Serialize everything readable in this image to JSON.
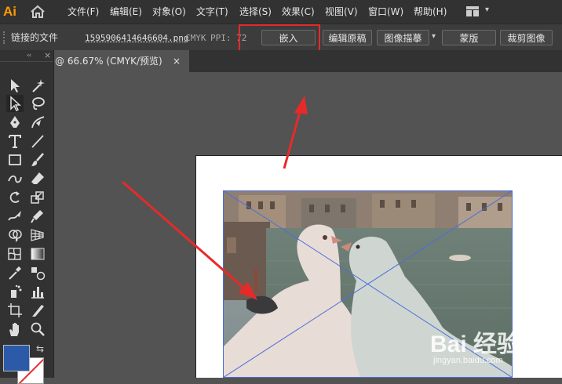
{
  "app": {
    "logo_text": "Ai",
    "icons": {
      "home": "home-icon",
      "workspace": "workspace-switcher-icon"
    }
  },
  "menu": [
    "文件(F)",
    "编辑(E)",
    "对象(O)",
    "文字(T)",
    "选择(S)",
    "效果(C)",
    "视图(V)",
    "窗口(W)",
    "帮助(H)"
  ],
  "control_bar": {
    "linked_label": "链接的文件",
    "filename": "1595906414646604.png",
    "color_mode": "CMYK",
    "ppi": "PPI: 72",
    "buttons": {
      "embed": "嵌入",
      "edit_original": "编辑原稿",
      "image_trace": "图像描摹",
      "mask": "蒙版",
      "crop": "裁剪图像"
    }
  },
  "document_tab": {
    "label": "@ 66.67% (CMYK/预览)",
    "close": "×"
  },
  "toolbar": {
    "tools": [
      "selection-tool",
      "magic-wand-tool",
      "direct-selection-tool",
      "lasso-tool",
      "pen-tool",
      "curvature-tool",
      "type-tool",
      "line-segment-tool",
      "rectangle-tool",
      "paintbrush-tool",
      "shaper-tool",
      "eraser-tool",
      "rotate-tool",
      "scale-tool",
      "warp-tool",
      "free-transform-tool",
      "shape-builder-tool",
      "perspective-grid-tool",
      "mesh-tool",
      "gradient-tool",
      "eyedropper-tool",
      "blend-tool",
      "symbol-sprayer-tool",
      "column-graph-tool",
      "artboard-tool",
      "slice-tool",
      "hand-tool",
      "zoom-tool"
    ],
    "collapse": "‹‹",
    "close": "×",
    "swap": "⇆",
    "fill_color": "#2C5AA8",
    "stroke_color": "#FFFFFF"
  },
  "watermark": {
    "brand": "Bai 经验",
    "sub": "jingyan.baidu.com"
  },
  "colors": {
    "highlight": "#E62A2A",
    "arrow": "#E62A2A",
    "bounding_box": "#4A6FD8"
  }
}
